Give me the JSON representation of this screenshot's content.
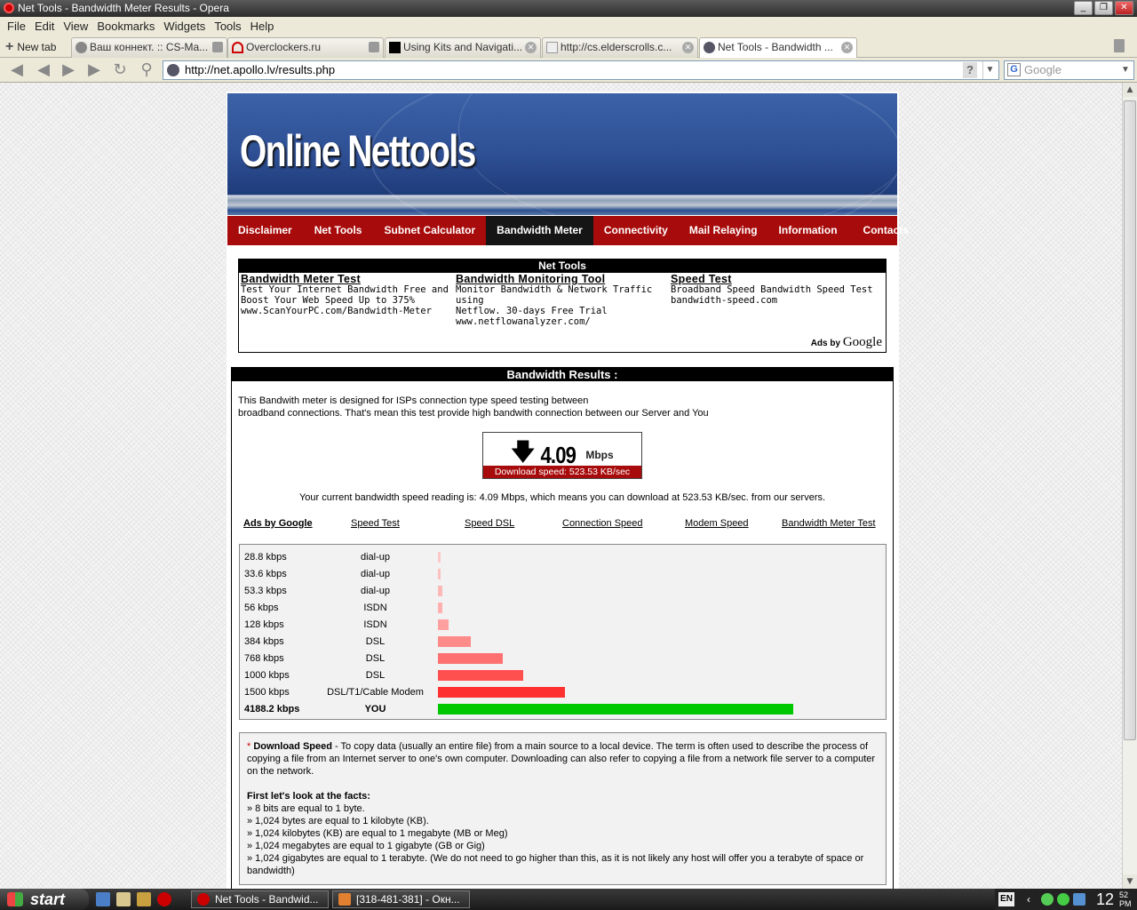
{
  "window": {
    "title": "Net Tools - Bandwidth Meter Results - Opera",
    "menu": [
      "File",
      "Edit",
      "View",
      "Bookmarks",
      "Widgets",
      "Tools",
      "Help"
    ]
  },
  "tabs": {
    "new_tab_label": "New tab",
    "items": [
      {
        "label": "Ваш коннект. :: CS-Ma..."
      },
      {
        "label": "Overclockers.ru"
      },
      {
        "label": "Using Kits and Navigati..."
      },
      {
        "label": "http://cs.elderscrolls.c..."
      },
      {
        "label": "Net Tools - Bandwidth ..."
      }
    ]
  },
  "address": {
    "url": "http://net.apollo.lv/results.php",
    "search_placeholder": "Google"
  },
  "site": {
    "logo": "Online Nettools",
    "nav": [
      "Disclaimer",
      "Net Tools",
      "Subnet Calculator",
      "Bandwidth Meter",
      "Connectivity",
      "Mail Relaying",
      "Information",
      "Contacts"
    ],
    "nav_active": "Bandwidth Meter"
  },
  "ads_top": {
    "header": "Net Tools",
    "ads": [
      {
        "title": "Bandwidth Meter Test",
        "line1": "Test Your Internet Bandwidth Free and",
        "line2": "Boost Your Web Speed Up to 375%",
        "url": "www.ScanYourPC.com/Bandwidth-Meter"
      },
      {
        "title": "Bandwidth Monitoring Tool",
        "line1": "Monitor Bandwidth & Network Traffic using",
        "line2": "Netflow. 30-days Free Trial",
        "url": "www.netflowanalyzer.com/"
      },
      {
        "title": "Speed Test",
        "line1": "Broadband Speed Bandwidth Speed Test",
        "line2": "bandwidth-speed.com",
        "url": ""
      }
    ],
    "ads_by": "Ads by",
    "google": "Google"
  },
  "results": {
    "header": "Bandwidth Results :",
    "intro_line1": "This Bandwith meter is designed for ISPs connection type speed testing between",
    "intro_line2": "broadband connections. That's mean this test provide high bandwith connection between our Server and You",
    "meter_value": "4.09",
    "meter_unit": "Mbps",
    "meter_sub": "Download speed: 523.53 KB/sec",
    "reading": "Your current bandwidth speed reading is: 4.09 Mbps, which means you can download at 523.53 KB/sec. from our servers.",
    "ad_links": [
      "Ads by Google",
      "Speed Test",
      "Speed DSL",
      "Connection Speed",
      "Modem Speed",
      "Bandwidth Meter Test"
    ]
  },
  "chart_data": {
    "type": "bar",
    "categories": [
      "28.8 kbps",
      "33.6 kbps",
      "53.3 kbps",
      "56 kbps",
      "128 kbps",
      "384 kbps",
      "768 kbps",
      "1000 kbps",
      "1500 kbps",
      "4188.2 kbps"
    ],
    "connection_types": [
      "dial-up",
      "dial-up",
      "dial-up",
      "ISDN",
      "ISDN",
      "DSL",
      "DSL",
      "DSL",
      "DSL/T1/Cable Modem",
      "YOU"
    ],
    "values": [
      28.8,
      33.6,
      53.3,
      56,
      128,
      384,
      768,
      1000,
      1500,
      4188.2
    ],
    "colors": [
      "#ffc8c8",
      "#ffc0c0",
      "#ffb8b8",
      "#ffb0b0",
      "#ffa0a0",
      "#ff8a8a",
      "#ff7070",
      "#ff5050",
      "#ff3030",
      "#00c800"
    ],
    "xlabel": "",
    "ylabel": ""
  },
  "notes": {
    "star": "*",
    "term": "Download Speed",
    "definition": " - To copy data (usually an entire file) from a main source to a local device. The term is often used to describe the process of copying a file from an Internet server to one's own computer. Downloading can also refer to copying a file from a network file server to a computer on the network.",
    "facts_title": "First let's look at the facts:",
    "facts": [
      "» 8 bits are equal to 1 byte.",
      "» 1,024 bytes are equal to 1 kilobyte (KB).",
      "» 1,024 kilobytes (KB) are equal to 1 megabyte (MB or Meg)",
      "» 1,024 megabytes are equal to 1 gigabyte (GB or Gig)",
      "» 1,024 gigabytes are equal to 1 terabyte. (We do not need to go higher than this, as it is not likely any host will offer you a terabyte of space or bandwidth)"
    ]
  },
  "taskbar": {
    "start": "start",
    "tasks": [
      "Net Tools - Bandwid...",
      "[318-481-381] - Окн..."
    ],
    "lang": "EN",
    "clock": "12",
    "ampm": "52 PM"
  }
}
